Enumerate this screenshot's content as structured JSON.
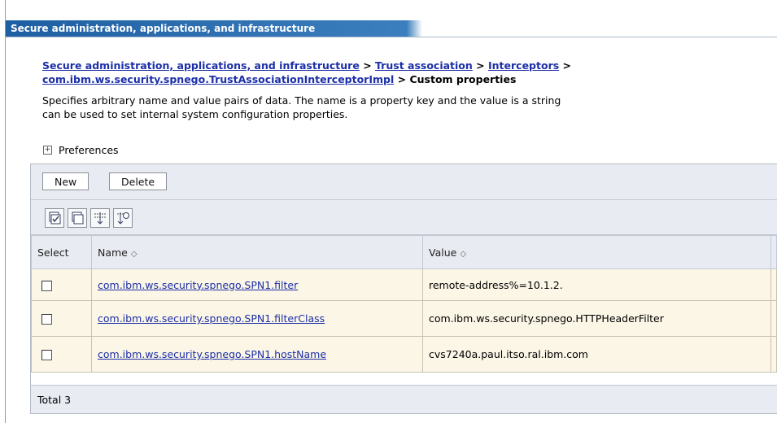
{
  "window": {
    "title": "Secure administration, applications, and infrastructure"
  },
  "breadcrumb": {
    "link1": "Secure administration, applications, and infrastructure",
    "sep": ">",
    "link2": "Trust association",
    "link3": "Interceptors",
    "link4": "com.ibm.ws.security.spnego.TrustAssociationInterceptorImpl",
    "current": "Custom properties"
  },
  "description": {
    "line1": "Specifies arbitrary name and value pairs of data. The name is a property key and the value is a string",
    "line2": "can be used to set internal system configuration properties."
  },
  "preferences": {
    "label": "Preferences",
    "icon": "expand-plus-icon"
  },
  "toolbar": {
    "new_label": "New",
    "delete_label": "Delete"
  },
  "icon_toolbar": [
    "select-all-icon",
    "deselect-all-icon",
    "expand-collapse-icon",
    "filter-icon"
  ],
  "table": {
    "columns": {
      "select": "Select",
      "name": "Name",
      "value": "Value",
      "sort_glyph": "◇"
    },
    "rows": [
      {
        "name": "com.ibm.ws.security.spnego.SPN1.filter",
        "value": "remote-address%=10.1.2."
      },
      {
        "name": "com.ibm.ws.security.spnego.SPN1.filterClass",
        "value": "com.ibm.ws.security.spnego.HTTPHeaderFilter"
      },
      {
        "name": "com.ibm.ws.security.spnego.SPN1.hostName",
        "value": "cvs7240a.paul.itso.ral.ibm.com"
      }
    ],
    "total": "Total 3"
  },
  "colors": {
    "title_blue": "#1e5fa3",
    "link": "#1c2fa8",
    "row_bg": "#fbf6e6",
    "header_bg": "#e8ebf1"
  }
}
